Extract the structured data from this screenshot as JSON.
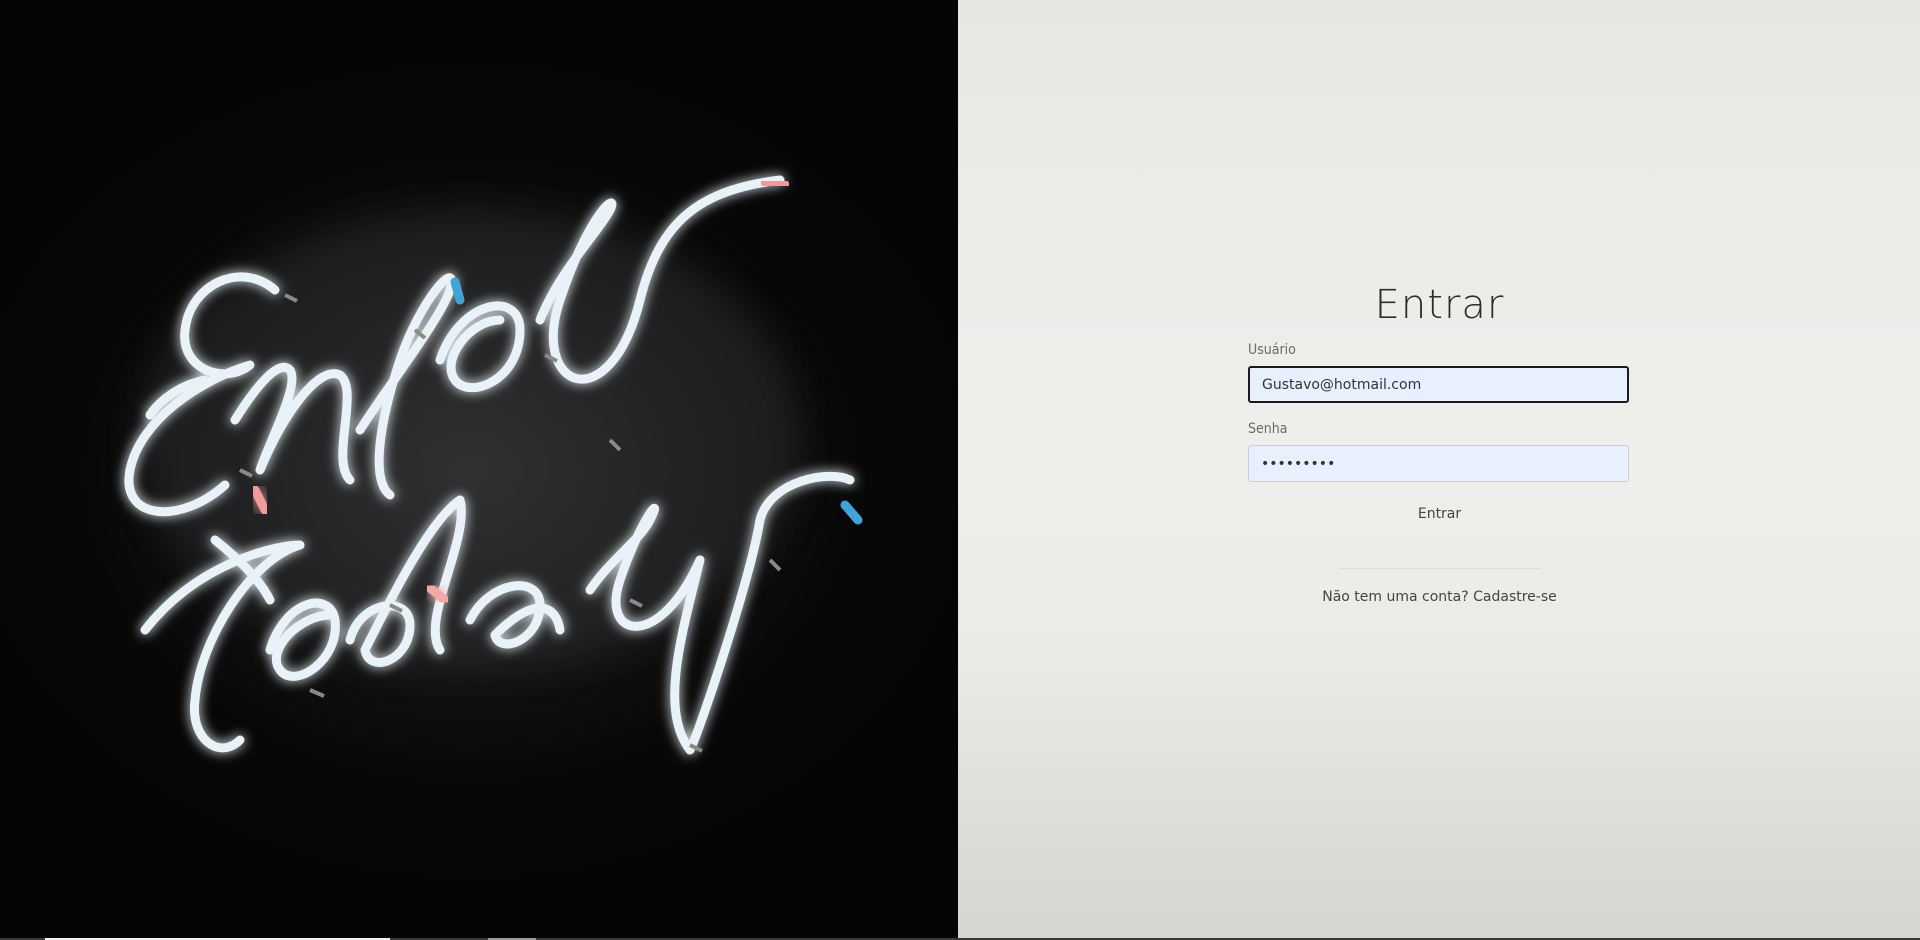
{
  "login": {
    "title": "Entrar",
    "username_label": "Usuário",
    "username_value": "Gustavo@hotmail.com",
    "password_label": "Senha",
    "password_value": "•••••••••",
    "submit_label": "Entrar",
    "signup_prompt": "Não tem uma conta?",
    "signup_link": "Cadastre-se"
  },
  "photo": {
    "neon_text_line1": "Enjoy",
    "neon_text_line2": "Today"
  },
  "colors": {
    "neon_white": "#e8f1f6",
    "neon_glow": "#bcd6e4",
    "neon_pink": "#f29a9a",
    "neon_blue": "#3ea5d6",
    "input_bg": "#e8f0fe"
  }
}
